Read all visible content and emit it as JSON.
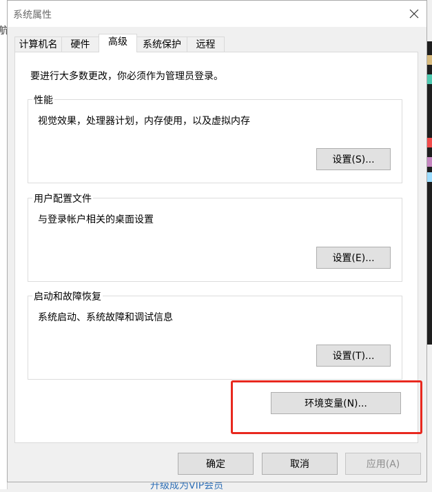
{
  "background": {
    "left_fragment": "航",
    "bottom_link": "升级成为VIP会员"
  },
  "window": {
    "title": "系统属性",
    "close_glyph": "✕"
  },
  "tabs": [
    {
      "label": "计算机名"
    },
    {
      "label": "硬件"
    },
    {
      "label": "高级",
      "active": true
    },
    {
      "label": "系统保护"
    },
    {
      "label": "远程"
    }
  ],
  "notice": "要进行大多数更改，你必须作为管理员登录。",
  "groups": {
    "performance": {
      "title": "性能",
      "description": "视觉效果，处理器计划，内存使用，以及虚拟内存",
      "button": "设置(S)..."
    },
    "user_profiles": {
      "title": "用户配置文件",
      "description": "与登录帐户相关的桌面设置",
      "button": "设置(E)..."
    },
    "startup_recovery": {
      "title": "启动和故障恢复",
      "description": "系统启动、系统故障和调试信息",
      "button": "设置(T)..."
    }
  },
  "env_button": "环境变量(N)...",
  "footer": {
    "ok": "确定",
    "cancel": "取消",
    "apply": "应用(A)"
  },
  "colors": {
    "highlight": "#e8281e",
    "link": "#2f6fb6"
  }
}
